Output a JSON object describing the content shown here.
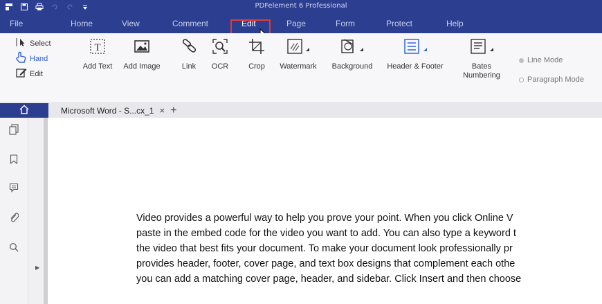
{
  "app": {
    "title": "PDFelement 6 Professional"
  },
  "menu": [
    "File",
    "Home",
    "View",
    "Comment",
    "Edit",
    "Page",
    "Form",
    "Protect",
    "Help"
  ],
  "active_menu": "Edit",
  "ribbon": {
    "select_group": {
      "select": "Select",
      "hand": "Hand",
      "edit": "Edit"
    },
    "tools": [
      {
        "label": "Add Text",
        "icon": "add-text-icon"
      },
      {
        "label": "Add Image",
        "icon": "add-image-icon"
      },
      {
        "label": "Link",
        "icon": "link-icon"
      },
      {
        "label": "OCR",
        "icon": "ocr-icon"
      },
      {
        "label": "Crop",
        "icon": "crop-icon"
      },
      {
        "label": "Watermark",
        "icon": "watermark-icon"
      },
      {
        "label": "Background",
        "icon": "background-icon"
      },
      {
        "label": "Header & Footer",
        "icon": "header-footer-icon"
      },
      {
        "label": "Bates\nNumbering",
        "icon": "bates-numbering-icon"
      }
    ],
    "modes": {
      "line": "Line Mode",
      "paragraph": "Paragraph Mode"
    }
  },
  "tabs": {
    "doc": "Microsoft Word - S...cx_1",
    "close": "×",
    "new": "+"
  },
  "document": {
    "lines": [
      "Video provides a powerful way to help you prove your point. When you click Online V",
      "paste in the embed code for the video you want to add. You can also type a keyword t",
      "the video that best fits your document. To make your document look professionally pr",
      "provides header, footer, cover page, and text box designs that complement each othe",
      "you can add a matching cover page, header, and sidebar. Click Insert and then choose"
    ]
  },
  "colors": {
    "brand": "#2c3e8f",
    "accent": "#3d6fd6",
    "highlight": "#e53935"
  }
}
